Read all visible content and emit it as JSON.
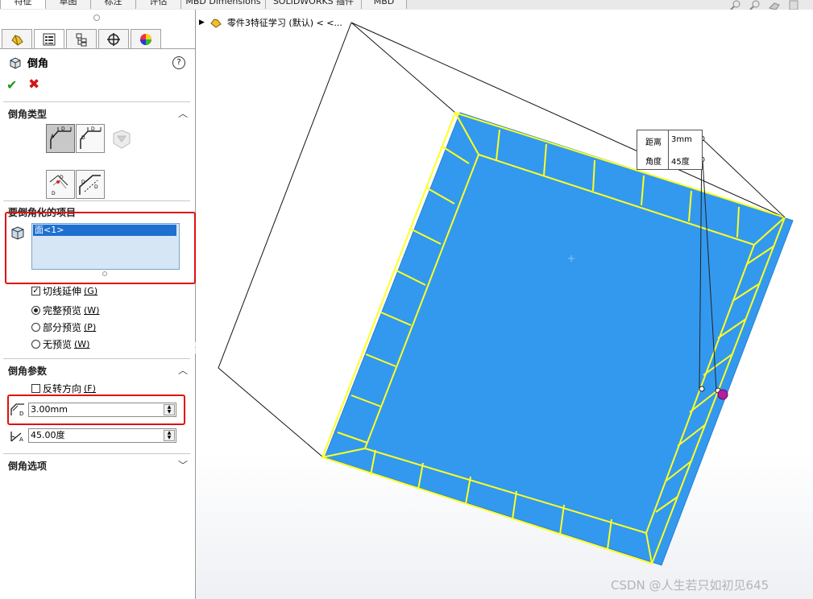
{
  "top_tabs": [
    "特征",
    "草图",
    "标注",
    "评估",
    "MBD Dimensions",
    "SOLIDWORKS 插件",
    "MBD"
  ],
  "panel": {
    "title": "倒角",
    "help": "?",
    "ok": "✔",
    "cancel": "✖",
    "section_type": "倒角类型",
    "section_items": "要倒角化的项目",
    "selected_item": "面<1>",
    "tangent_propagation": "切线延伸",
    "tangent_key": "(G)",
    "preview_full": "完整预览",
    "preview_full_key": "(W)",
    "preview_partial": "部分预览",
    "preview_partial_key": "(P)",
    "preview_none": "无预览",
    "preview_none_key": "(W)",
    "section_params": "倒角参数",
    "reverse_direction": "反转方向",
    "reverse_key": "(F)",
    "distance_value": "3.00mm",
    "angle_value": "45.00度",
    "section_options": "倒角选项",
    "selected_preview": "full",
    "tangent_checked": true,
    "reverse_checked": false
  },
  "tree": {
    "part_name": "零件3特征学习 (默认) < <..."
  },
  "callout": {
    "distance_label": "距离",
    "distance_value": "3mm",
    "angle_label": "角度",
    "angle_value": "45度"
  },
  "colors": {
    "face_blue": "#3399ee",
    "edge_yellow": "#ffff22",
    "selection_blue": "#1f6fd1",
    "highlight_red": "#e01010"
  },
  "watermark": "CSDN @人生若只如初见645"
}
